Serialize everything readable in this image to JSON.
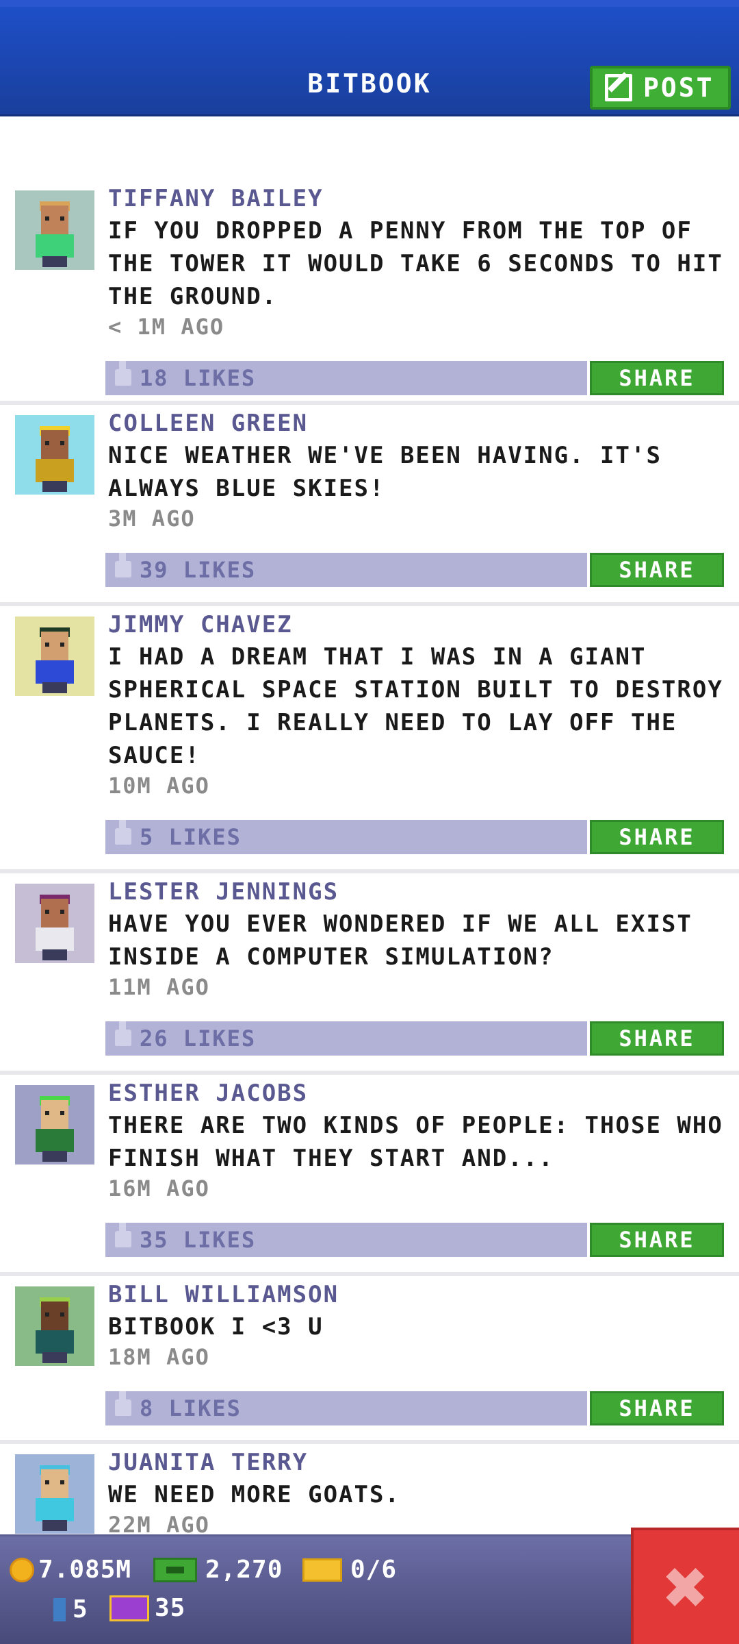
{
  "header": {
    "title": "BITBOOK",
    "post_label": "POST"
  },
  "posts": [
    {
      "author": "TIFFANY BAILEY",
      "text": "IF YOU DROPPED A PENNY FROM THE TOP OF THE TOWER IT WOULD TAKE 6 SECONDS TO HIT THE GROUND.",
      "time": "< 1M AGO",
      "likes": "18 LIKES",
      "share": "SHARE",
      "avatar_bg": "#a9c7bf",
      "hair": "#d9a35a",
      "shirt": "#3fd07a",
      "skin": "#c08258"
    },
    {
      "author": "COLLEEN GREEN",
      "text": "NICE WEATHER WE'VE BEEN HAVING. IT'S ALWAYS BLUE SKIES!",
      "time": "3M AGO",
      "likes": "39 LIKES",
      "share": "SHARE",
      "avatar_bg": "#8fdcea",
      "hair": "#f0d02a",
      "shirt": "#c9a020",
      "skin": "#9a6040"
    },
    {
      "author": "JIMMY CHAVEZ",
      "text": "I HAD A DREAM THAT I WAS IN A GIANT SPHERICAL SPACE STATION BUILT TO DESTROY PLANETS. I REALLY NEED TO LAY OFF THE SAUCE!",
      "time": "10M AGO",
      "likes": "5 LIKES",
      "share": "SHARE",
      "avatar_bg": "#e4e3a3",
      "hair": "#1f3a25",
      "shirt": "#2c4ad6",
      "skin": "#d2a070"
    },
    {
      "author": "LESTER JENNINGS",
      "text": "HAVE YOU EVER WONDERED IF WE ALL EXIST INSIDE A COMPUTER SIMULATION?",
      "time": "11M AGO",
      "likes": "26 LIKES",
      "share": "SHARE",
      "avatar_bg": "#c6bed4",
      "hair": "#7a2a6a",
      "shirt": "#e8e8ee",
      "skin": "#b07050"
    },
    {
      "author": "ESTHER JACOBS",
      "text": "THERE ARE TWO KINDS OF PEOPLE: THOSE WHO FINISH WHAT THEY START AND...",
      "time": "16M AGO",
      "likes": "35 LIKES",
      "share": "SHARE",
      "avatar_bg": "#9ea0c6",
      "hair": "#4ad84a",
      "shirt": "#2a7a3a",
      "skin": "#e0b888"
    },
    {
      "author": "BILL WILLIAMSON",
      "text": "BITBOOK I <3 U",
      "time": "18M AGO",
      "likes": "8 LIKES",
      "share": "SHARE",
      "avatar_bg": "#88bb88",
      "hair": "#9ad04a",
      "shirt": "#1f5a5a",
      "skin": "#6a4028"
    },
    {
      "author": "JUANITA TERRY",
      "text": "WE NEED MORE GOATS.",
      "time": "22M AGO",
      "likes": "",
      "share": "",
      "avatar_bg": "#9db4d8",
      "hair": "#4ac0e0",
      "shirt": "#40c8e0",
      "skin": "#e0b888"
    }
  ],
  "status": {
    "coins": "7.085M",
    "bux": "2,270",
    "tickets": "0/6",
    "floors": "5",
    "vip": "35",
    "close_glyph": "✖"
  }
}
